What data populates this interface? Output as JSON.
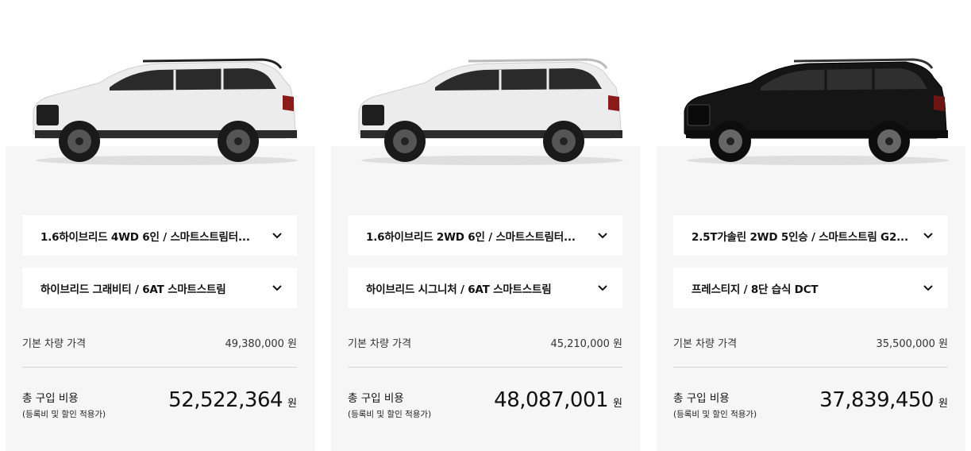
{
  "colors": {
    "card_bg": "#f6f6f6",
    "white_car": "#ececec",
    "black_car": "#151515"
  },
  "cards": [
    {
      "car_color": "white",
      "trim_select": "1.6하이브리드 4WD 6인 / 스마트스트림터...",
      "grade_select": "하이브리드 그래비티 / 6AT 스마트스트림",
      "base_label": "기본 차량 가격",
      "base_price": "49,380,000",
      "base_unit": "원",
      "total_label": "총 구입 비용",
      "total_sub": "(등록비 및 할인 적용가)",
      "total_price": "52,522,364",
      "total_unit": "원"
    },
    {
      "car_color": "white",
      "trim_select": "1.6하이브리드 2WD 6인 / 스마트스트림터...",
      "grade_select": "하이브리드 시그니처 / 6AT 스마트스트림",
      "base_label": "기본 차량 가격",
      "base_price": "45,210,000",
      "base_unit": "원",
      "total_label": "총 구입 비용",
      "total_sub": "(등록비 및 할인 적용가)",
      "total_price": "48,087,001",
      "total_unit": "원"
    },
    {
      "car_color": "black",
      "trim_select": "2.5T가솔린 2WD 5인승 / 스마트스트림 G2...",
      "grade_select": "프레스티지 / 8단 습식 DCT",
      "base_label": "기본 차량 가격",
      "base_price": "35,500,000",
      "base_unit": "원",
      "total_label": "총 구입 비용",
      "total_sub": "(등록비 및 할인 적용가)",
      "total_price": "37,839,450",
      "total_unit": "원"
    }
  ]
}
